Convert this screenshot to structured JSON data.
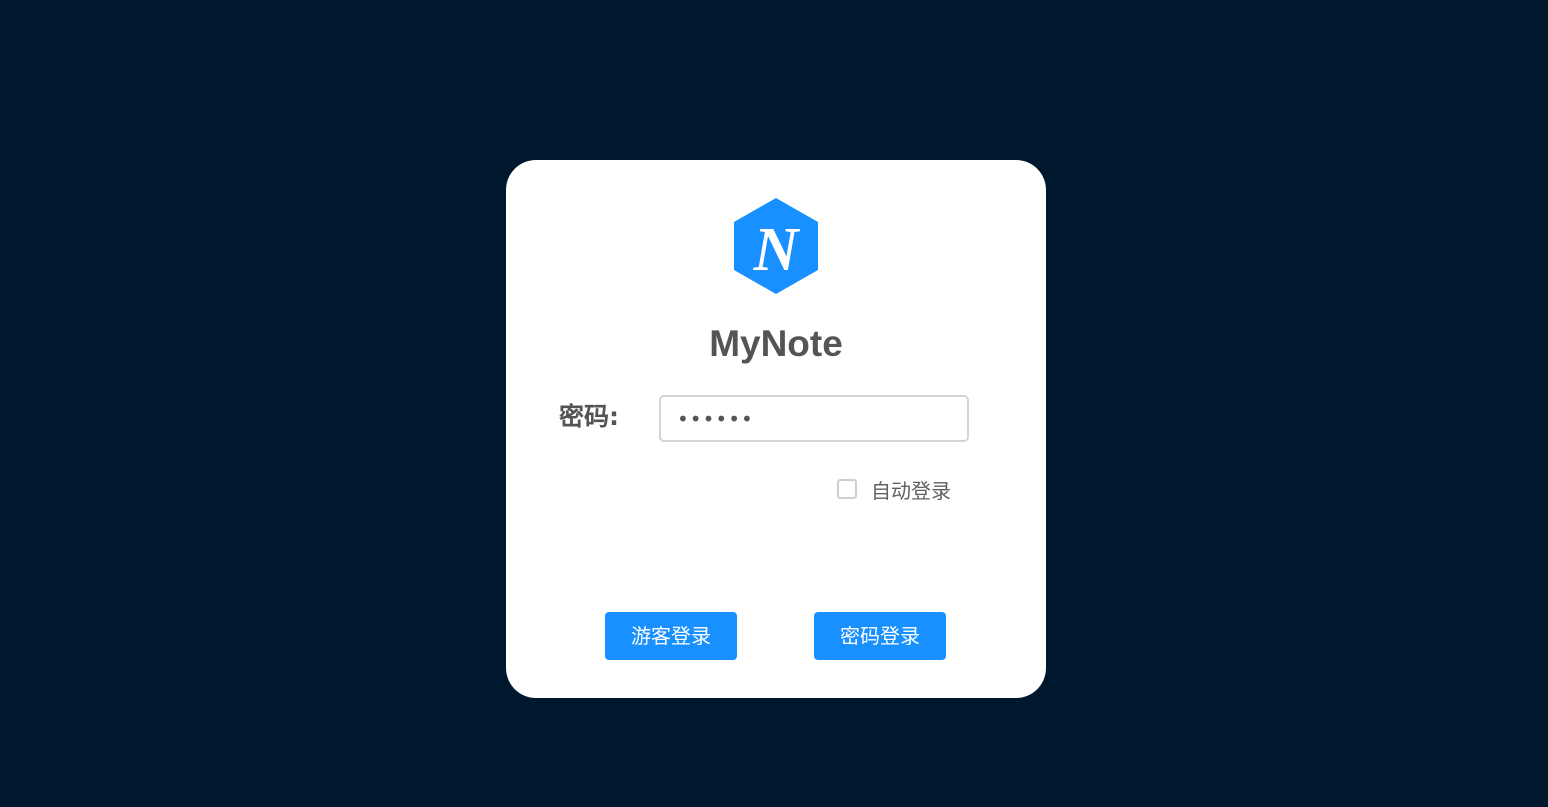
{
  "app": {
    "title": "MyNote",
    "logo_letter": "N",
    "logo_icon": "hexagon-n-logo-icon"
  },
  "login": {
    "password_label": "密码:",
    "password_value": "••••••",
    "auto_login_label": "自动登录",
    "auto_login_checked": false,
    "guest_login_label": "游客登录",
    "password_login_label": "密码登录"
  },
  "colors": {
    "background": "#00182d",
    "card": "#ffffff",
    "accent": "#1890ff",
    "title_text": "#545454"
  }
}
